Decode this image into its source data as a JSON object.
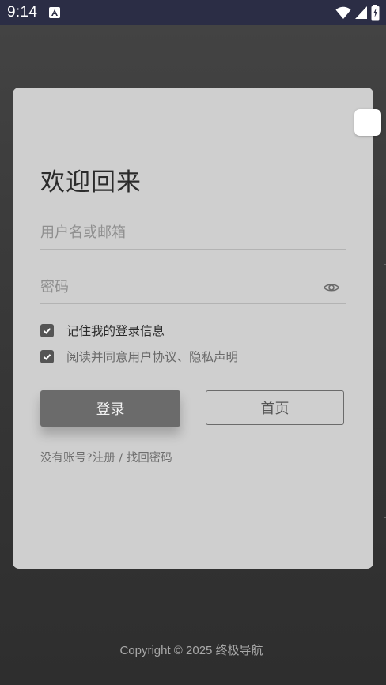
{
  "status_bar": {
    "time": "9:14",
    "icons": [
      "notification-a-icon",
      "wifi-icon",
      "cellular-signal-icon",
      "battery-charging-icon"
    ]
  },
  "login": {
    "title": "欢迎回来",
    "username_placeholder": "用户名或邮箱",
    "password_placeholder": "密码",
    "remember_label": "记住我的登录信息",
    "remember_checked": true,
    "agree_label": "阅读并同意用户协议、隐私声明",
    "agree_checked": true,
    "login_button": "登录",
    "home_button": "首页",
    "no_account": "没有账号?",
    "register": "注册",
    "separator": " / ",
    "forgot_password": "找回密码"
  },
  "footer": {
    "copyright": "Copyright © 2025 终极导航"
  },
  "colors": {
    "status_bar": "#2b2d45",
    "card": "#cfcfcf",
    "primary_button": "#6b6b6b",
    "checkbox": "#555555"
  }
}
